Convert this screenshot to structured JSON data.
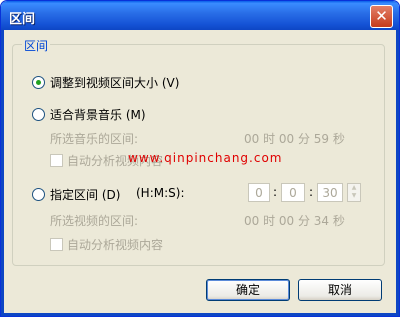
{
  "window": {
    "title": "区间",
    "close_symbol": "✕"
  },
  "group": {
    "legend": "区间"
  },
  "option_resize": {
    "label": "调整到视频区间大小 (V)",
    "selected": true
  },
  "option_music": {
    "label": "适合背景音乐 (M)",
    "selected": false,
    "range_label": "所选音乐的区间:",
    "range_value": "00 时 00 分 59 秒",
    "auto_analyze": "自动分析视频内容"
  },
  "watermark": "www.qinpinchang.com",
  "option_specified": {
    "label": "指定区间 (D)",
    "format": "(H:M:S):",
    "selected": false,
    "hours": "0",
    "minutes": "0",
    "seconds": "30",
    "colon": ":",
    "range_label": "所选视频的区间:",
    "range_value": "00 时 00 分 34 秒",
    "auto_analyze": "自动分析视频内容"
  },
  "buttons": {
    "ok": "确定",
    "cancel": "取消"
  },
  "colors": {
    "title_bar": "#1553d6",
    "accent_legend": "#0046d5",
    "dialog_bg": "#ece9d8",
    "watermark": "#e00000"
  }
}
